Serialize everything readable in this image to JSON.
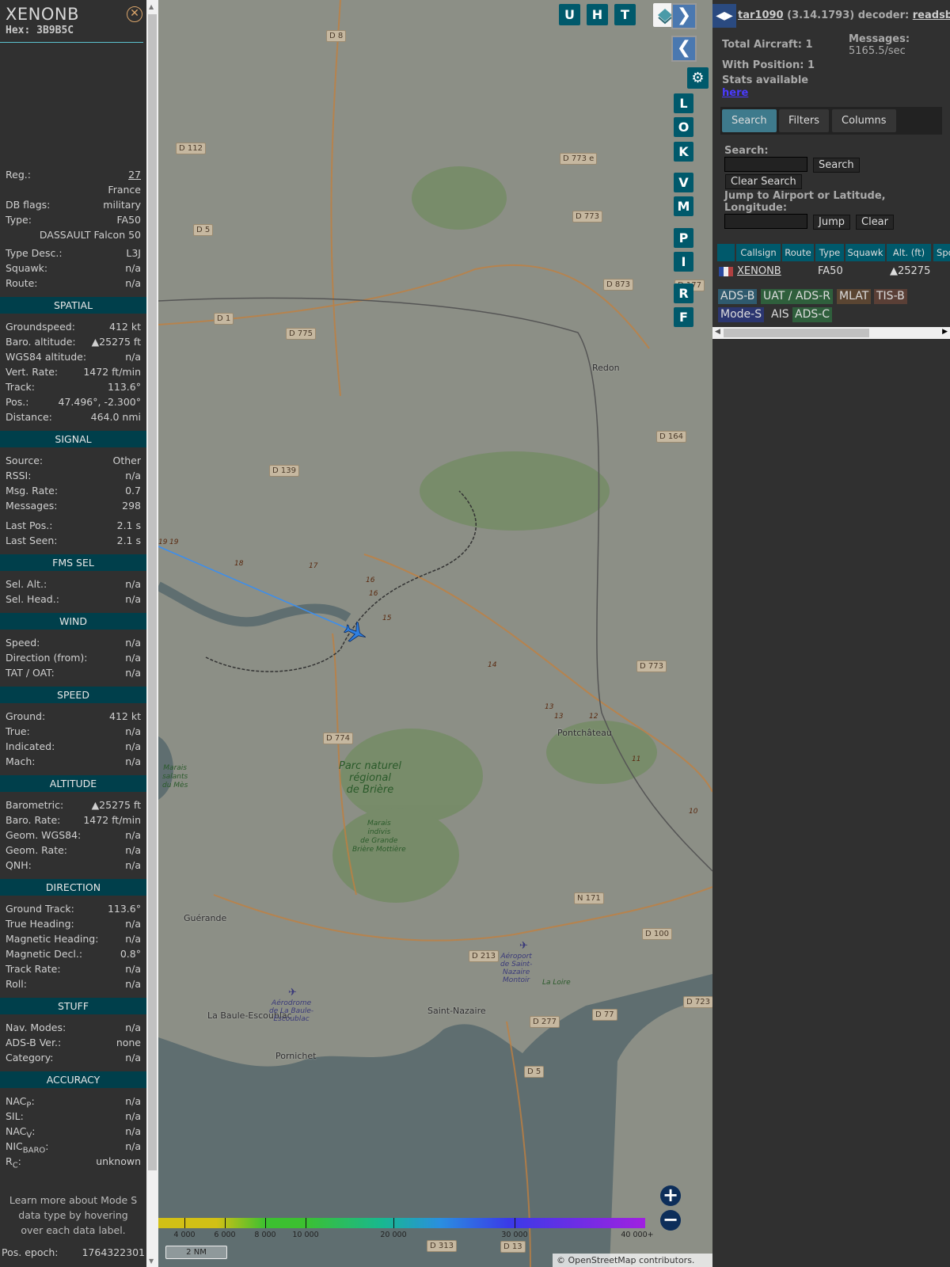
{
  "detail": {
    "callsign": "XENONB",
    "hex_label": "Hex:",
    "hex": "3B9B5C",
    "sections": [
      {
        "title": "",
        "rows": [
          {
            "label": "Reg.:",
            "value": "27"
          },
          {
            "label": "",
            "value": "France"
          },
          {
            "label": "DB flags:",
            "value": "military"
          },
          {
            "label": "Type:",
            "value": "FA50"
          },
          {
            "label": "",
            "value": "DASSAULT Falcon 50"
          },
          {
            "label": "Type Desc.:",
            "value": "L3J"
          },
          {
            "label": "Squawk:",
            "value": "n/a"
          },
          {
            "label": "Route:",
            "value": "n/a"
          }
        ]
      },
      {
        "title": "SPATIAL",
        "rows": [
          {
            "label": "Groundspeed:",
            "value": "412 kt"
          },
          {
            "label": "Baro. altitude:",
            "value": "▲25275 ft"
          },
          {
            "label": "WGS84 altitude:",
            "value": "n/a"
          },
          {
            "label": "Vert. Rate:",
            "value": "1472 ft/min"
          },
          {
            "label": "Track:",
            "value": "113.6°"
          },
          {
            "label": "Pos.:",
            "value": "47.496°, -2.300°"
          },
          {
            "label": "Distance:",
            "value": "464.0 nmi"
          }
        ]
      },
      {
        "title": "SIGNAL",
        "rows": [
          {
            "label": "Source:",
            "value": "Other"
          },
          {
            "label": "RSSI:",
            "value": "n/a"
          },
          {
            "label": "Msg. Rate:",
            "value": "0.7"
          },
          {
            "label": "Messages:",
            "value": "298"
          },
          {
            "label": "Last Pos.:",
            "value": "2.1 s"
          },
          {
            "label": "Last Seen:",
            "value": "2.1 s"
          }
        ]
      },
      {
        "title": "FMS SEL",
        "rows": [
          {
            "label": "Sel. Alt.:",
            "value": "n/a"
          },
          {
            "label": "Sel. Head.:",
            "value": "n/a"
          }
        ]
      },
      {
        "title": "WIND",
        "rows": [
          {
            "label": "Speed:",
            "value": "n/a"
          },
          {
            "label": "Direction (from):",
            "value": "n/a"
          },
          {
            "label": "TAT / OAT:",
            "value": "n/a"
          }
        ]
      },
      {
        "title": "SPEED",
        "rows": [
          {
            "label": "Ground:",
            "value": "412 kt"
          },
          {
            "label": "True:",
            "value": "n/a"
          },
          {
            "label": "Indicated:",
            "value": "n/a"
          },
          {
            "label": "Mach:",
            "value": "n/a"
          }
        ]
      },
      {
        "title": "ALTITUDE",
        "rows": [
          {
            "label": "Barometric:",
            "value": "▲25275 ft"
          },
          {
            "label": "Baro. Rate:",
            "value": "1472 ft/min"
          },
          {
            "label": "Geom. WGS84:",
            "value": "n/a"
          },
          {
            "label": "Geom. Rate:",
            "value": "n/a"
          },
          {
            "label": "QNH:",
            "value": "n/a"
          }
        ]
      },
      {
        "title": "DIRECTION",
        "rows": [
          {
            "label": "Ground Track:",
            "value": "113.6°"
          },
          {
            "label": "True Heading:",
            "value": "n/a"
          },
          {
            "label": "Magnetic Heading:",
            "value": "n/a"
          },
          {
            "label": "Magnetic Decl.:",
            "value": "0.8°"
          },
          {
            "label": "Track Rate:",
            "value": "n/a"
          },
          {
            "label": "Roll:",
            "value": "n/a"
          }
        ]
      },
      {
        "title": "STUFF",
        "rows": [
          {
            "label": "Nav. Modes:",
            "value": "n/a"
          },
          {
            "label": "ADS-B Ver.:",
            "value": "none"
          },
          {
            "label": "Category:",
            "value": "n/a"
          }
        ]
      },
      {
        "title": "ACCURACY",
        "rows": [
          {
            "label": "NAC",
            "sub": "P",
            "value": "n/a"
          },
          {
            "label": "SIL:",
            "value": "n/a"
          },
          {
            "label": "NAC",
            "sub": "V",
            "value": "n/a"
          },
          {
            "label": "NIC",
            "sub": "BARO",
            "value": "n/a"
          },
          {
            "label": "R",
            "sub": "C",
            "value": "unknown"
          }
        ]
      }
    ],
    "note": "Learn more about Mode S data type by hovering over each data label.",
    "pos_epoch_label": "Pos. epoch:",
    "pos_epoch": "1764322301"
  },
  "map": {
    "top_buttons": [
      "U",
      "H",
      "T"
    ],
    "side_buttons": [
      "L",
      "O",
      "K",
      "V",
      "M",
      "P",
      "I",
      "R",
      "F"
    ],
    "road_labels": [
      "D 8",
      "D 112",
      "D 5",
      "D 773 e",
      "D 773",
      "D 873",
      "D 177",
      "D 1",
      "D 775",
      "D 164",
      "D 139",
      "D 773",
      "D 774",
      "N 171",
      "D 100",
      "D 213",
      "D 723",
      "D 77",
      "D 277",
      "D 5",
      "D 313",
      "D 13"
    ],
    "towns": [
      "Redon",
      "Pontchâteau",
      "Guérande",
      "La Baule-Escoublac",
      "Pornichet",
      "Saint-Nazaire"
    ],
    "parks": [
      "Parc naturel\nrégional\nde Brière"
    ],
    "small_areas": [
      "Marais\nindivis\nde Grande\nBrière Mottière",
      "Marais\nsalants\ndu Mès",
      "La Loire"
    ],
    "airports": [
      "Aérodrome\nde La Baule-\nEscoublac",
      "Aéroport\nde Saint-\nNazaire\nMontoir"
    ],
    "track_labels": [
      "19",
      "19",
      "18",
      "17",
      "16",
      "16",
      "15",
      "14",
      "13",
      "13",
      "12",
      "11",
      "10"
    ],
    "altitude_legend": {
      "ticks": [
        "4 000",
        "6 000",
        "8 000",
        "10 000",
        "20 000",
        "30 000",
        "40 000+"
      ]
    },
    "scale": "2 NM",
    "attribution_prefix": "©",
    "attribution_link": "OpenStreetMap",
    "attribution_suffix": "contributors.",
    "aircraft_color": "#2f7fe0"
  },
  "panel": {
    "app_link": "tar1090",
    "version": "(3.14.1793) decoder:",
    "decoder_link": "readsb",
    "total_aircraft": "Total Aircraft: 1",
    "with_position": "With Position: 1",
    "messages_label": "Messages:",
    "messages_rate": "5165.5/sec",
    "stats_text": "Stats available",
    "stats_link": "here",
    "tabs": [
      "Search",
      "Filters",
      "Columns"
    ],
    "active_tab": "Search",
    "search_label": "Search:",
    "search_value": "",
    "search_button": "Search",
    "clear_search_button": "Clear Search",
    "jump_label": "Jump to Airport or Latitude, Longitude:",
    "jump_value": "",
    "jump_button": "Jump",
    "clear_button": "Clear",
    "table": {
      "columns": [
        "",
        "Callsign",
        "Route",
        "Type",
        "Squawk",
        "Alt. (ft)",
        "Spd"
      ],
      "rows": [
        {
          "flag": "France",
          "callsign": "XENONB",
          "route": "",
          "type": "FA50",
          "squawk": "",
          "alt": "▲25275"
        }
      ]
    },
    "source_chips": [
      {
        "label": "ADS-B",
        "color": "#2f5a6e"
      },
      {
        "label": "UAT / ADS-R",
        "color": "#2f5f3c"
      },
      {
        "label": "MLAT",
        "color": "#5a4532"
      },
      {
        "label": "TIS-B",
        "color": "#5a3f36"
      },
      {
        "label": "Mode-S",
        "color": "#2b3670"
      },
      {
        "label": "AIS",
        "color": ""
      },
      {
        "label": "ADS-C",
        "color": "#2f5f3c"
      }
    ]
  }
}
